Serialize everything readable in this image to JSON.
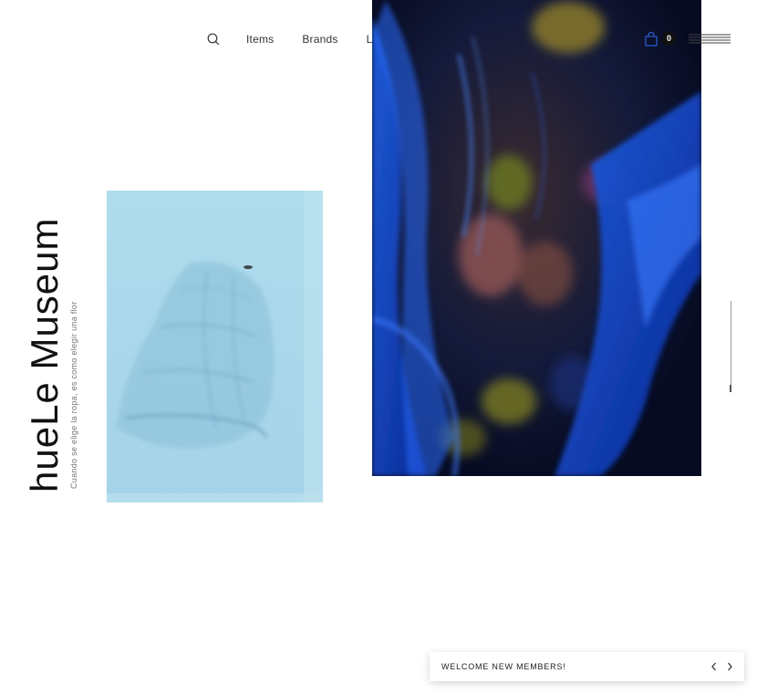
{
  "nav": {
    "items": [
      "Items",
      "Brands",
      "L/J"
    ]
  },
  "cart": {
    "count": "0"
  },
  "hero": {
    "title": "hueLe Museum",
    "subtitle": "Cuando se elige la ropa, es como elegir una flor"
  },
  "notice": {
    "text": "WELCOME NEW MEMBERS!"
  },
  "colors": {
    "text": "#222222",
    "badge": "#111111",
    "background": "#ffffff"
  },
  "icons": [
    "search-icon",
    "shopping-bag-icon",
    "hamburger-menu-icon",
    "chevron-left-icon",
    "chevron-right-icon"
  ]
}
